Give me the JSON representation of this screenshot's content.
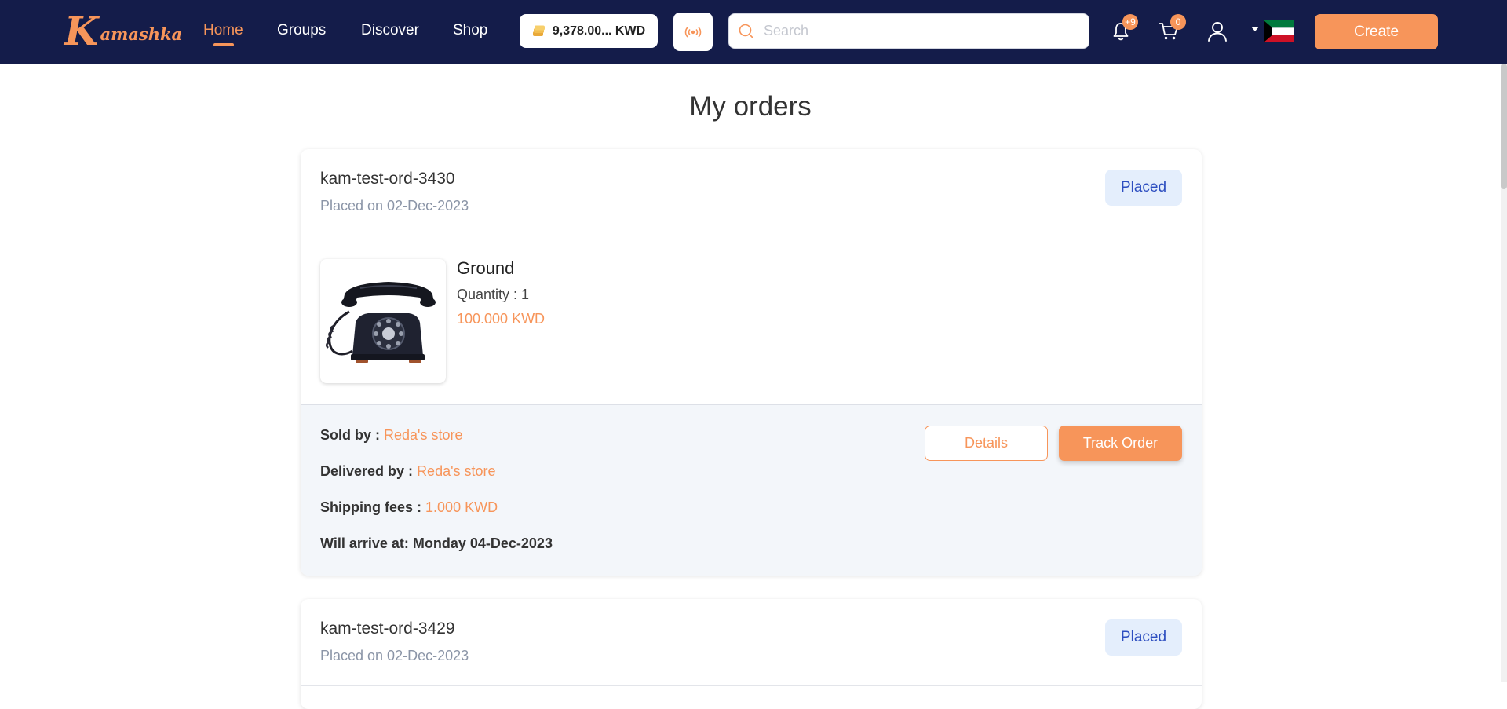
{
  "brand": {
    "logo_letter": "K",
    "logo_rest": "amashka"
  },
  "nav": {
    "links": [
      "Home",
      "Groups",
      "Discover",
      "Shop"
    ],
    "active": "Home"
  },
  "wallet": {
    "balance": "9,378.00... KWD"
  },
  "search": {
    "placeholder": "Search",
    "value": ""
  },
  "notifications": {
    "count": "+9"
  },
  "cart": {
    "count": "0"
  },
  "actions": {
    "create_label": "Create"
  },
  "page": {
    "title": "My orders"
  },
  "orders": [
    {
      "id": "kam-test-ord-3430",
      "placed_on": "Placed on 02-Dec-2023",
      "status": "Placed",
      "item": {
        "name": "Ground",
        "quantity": "Quantity : 1",
        "price": "100.000 KWD",
        "image_icon": "rotary-telephone-icon"
      },
      "sold_by_label": "Sold by :",
      "sold_by": "Reda's store",
      "delivered_by_label": "Delivered by :",
      "delivered_by": "Reda's store",
      "shipping_label": "Shipping fees :",
      "shipping": "1.000 KWD",
      "arrival": "Will arrive at: Monday 04-Dec-2023",
      "details_label": "Details",
      "track_label": "Track Order"
    },
    {
      "id": "kam-test-ord-3429",
      "placed_on": "Placed on 02-Dec-2023",
      "status": "Placed"
    }
  ],
  "colors": {
    "navbar": "#141c4a",
    "accent": "#f7955a",
    "status_bg": "#e4eefc",
    "status_text": "#2d4ec0"
  }
}
